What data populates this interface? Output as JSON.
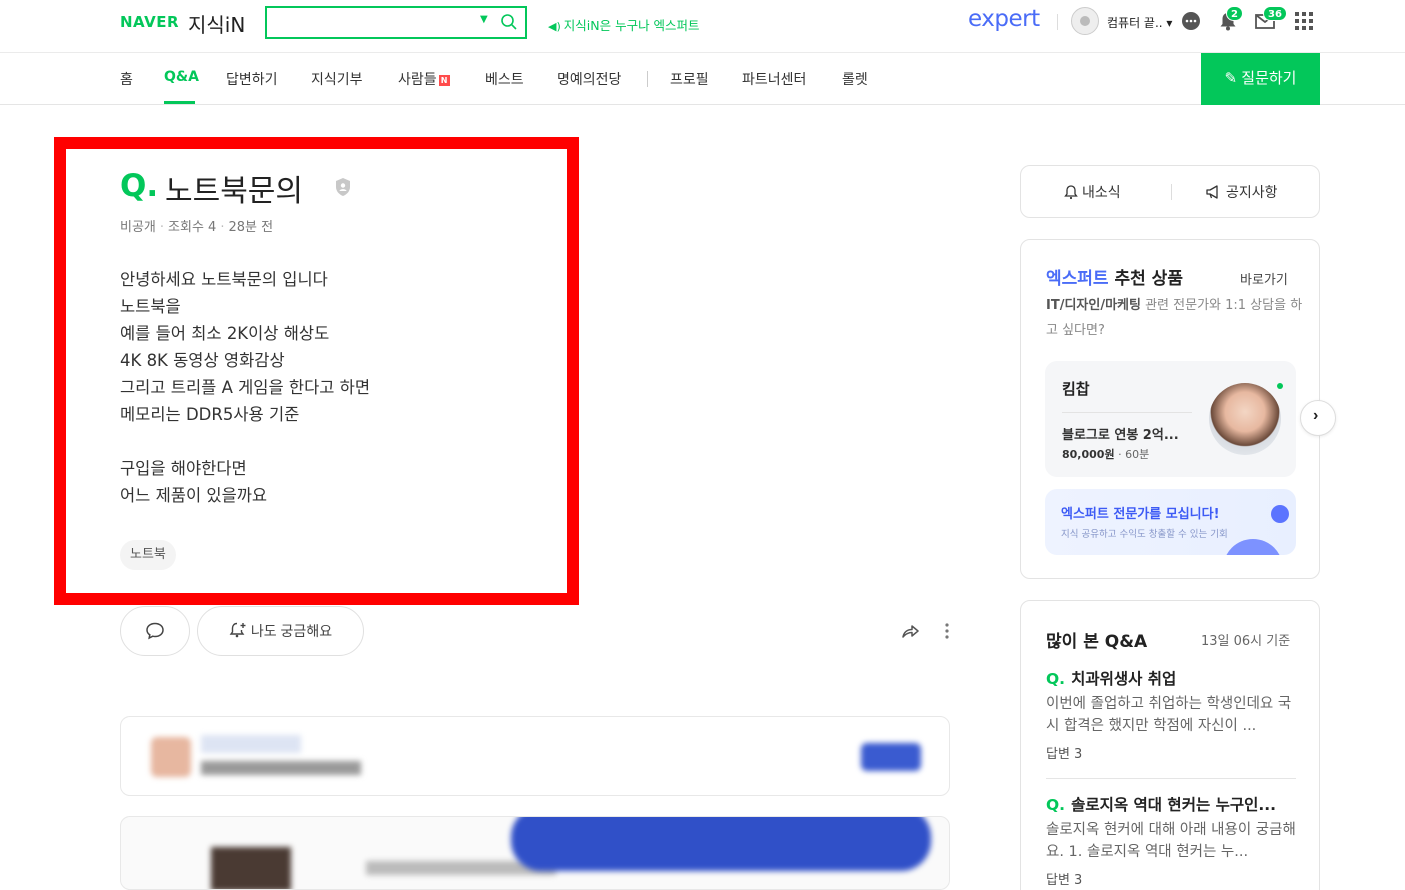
{
  "header": {
    "brand": "NAVER",
    "service": "지식iN",
    "search_placeholder": "",
    "notice": "지식iN은 누구나 엑스퍼트",
    "expert_logo": "expert",
    "user_name": "컴퓨터 끝.. ▾",
    "alarm_count": "2",
    "mail_count": "36"
  },
  "nav": {
    "items": [
      "홈",
      "Q&A",
      "답변하기",
      "지식기부",
      "사람들",
      "베스트",
      "명예의전당",
      "프로필",
      "파트너센터",
      "롤렛"
    ],
    "new_badge": "N",
    "ask_button": "질문하기"
  },
  "question": {
    "q_mark": "Q.",
    "title": "노트북문의",
    "visibility": "비공개",
    "views": "조회수 4",
    "time": "28분 전",
    "body_lines": [
      "안녕하세요 노트북문의 입니다",
      "노트북을",
      "예를 들어 최소 2K이상 해상도",
      "4K 8K 동영상 영화감상",
      "그리고 트리플 A 게임을 한다고 하면",
      "메모리는 DDR5사용 기준",
      "",
      "구입을 해야한다면",
      "어느 제품이 있을까요"
    ],
    "tag": "노트북",
    "curious_label": "나도 궁금해요"
  },
  "sidebar": {
    "my_news": "내소식",
    "notice": "공지사항",
    "expert": {
      "title_accent": "엑스퍼트",
      "title_rest": " 추천 상품",
      "link": "바로가기",
      "desc_bold": "IT/디자인/마케팅",
      "desc_rest": " 관련 전문가와 1:1 상담을 하고 싶다면?",
      "product_name": "킴찹",
      "product_title": "블로그로 연봉 2억...",
      "product_price": "80,000원",
      "product_duration": "60분",
      "recruit_title": "엑스퍼트 전문가를 모십니다!",
      "recruit_sub": "지식 공유하고 수익도 창출할 수 있는 기회"
    },
    "popular": {
      "title": "많이 본 Q&A",
      "date": "13일 06시 기준",
      "items": [
        {
          "title": "치과위생사 취업",
          "desc": "이번에 졸업하고 취업하는 학생인데요 국시 합격은 했지만 학점에 자신이 ...",
          "answers": "답변 3"
        },
        {
          "title": "솔로지옥 역대 현커는 누구인...",
          "desc": "솔로지옥 현커에 대해 아래 내용이 궁금해요. 1. 솔로지옥 역대 현커는 누...",
          "answers": "답변 3"
        }
      ]
    }
  },
  "colors": {
    "brand_green": "#03c75a",
    "expert_blue": "#4a6cf7",
    "highlight_red": "#ff0000"
  }
}
